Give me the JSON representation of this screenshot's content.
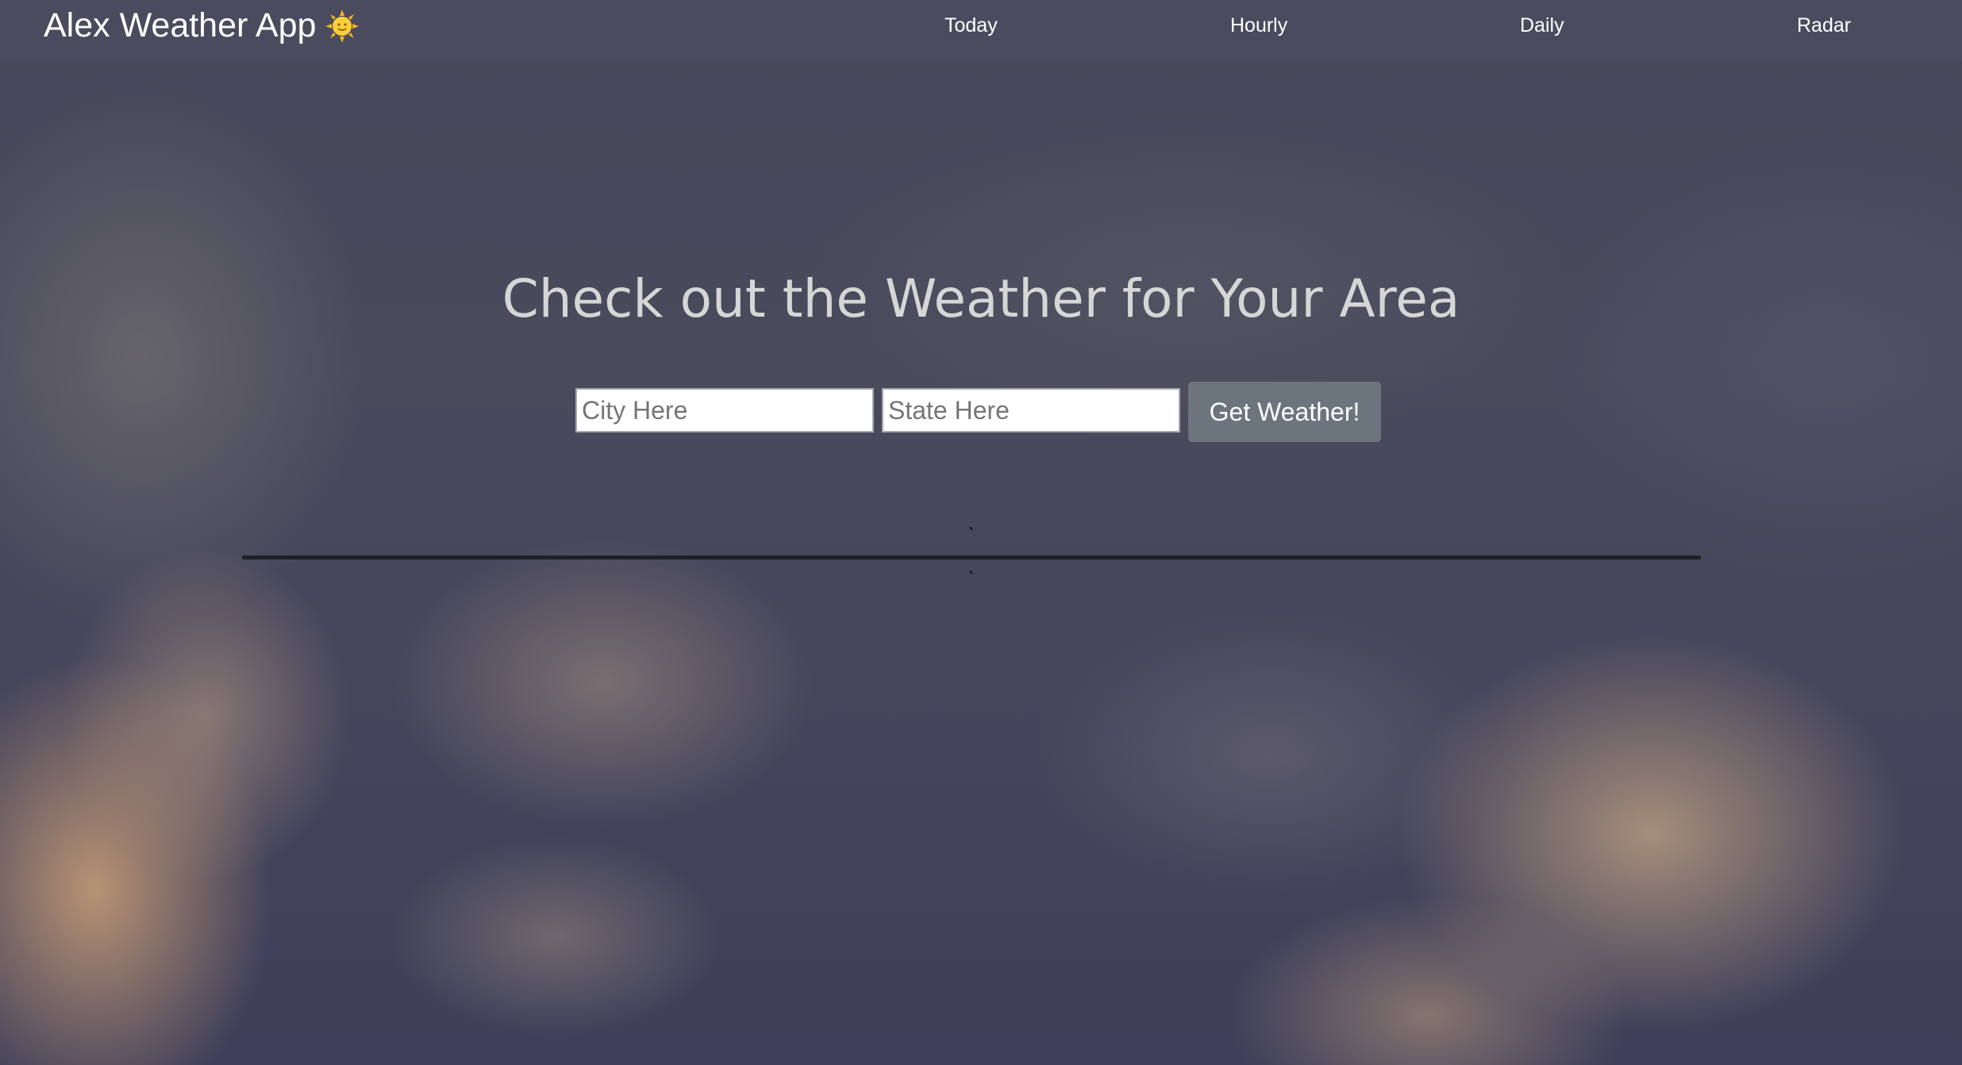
{
  "navbar": {
    "brand": "Alex Weather App",
    "brand_icon": "sun-with-face-icon",
    "links": [
      {
        "label": "Today"
      },
      {
        "label": "Hourly"
      },
      {
        "label": "Daily"
      },
      {
        "label": "Radar"
      }
    ]
  },
  "hero": {
    "title": "Check out the Weather for Your Area"
  },
  "search": {
    "city_placeholder": "City Here",
    "city_value": "",
    "state_placeholder": "State Here",
    "state_value": "",
    "submit_label": "Get Weather!"
  },
  "colors": {
    "navbar_bg": "#4b4b5f",
    "button_bg": "#6c757d",
    "title_text": "#d6d6d6",
    "divider": "#1f2024"
  }
}
